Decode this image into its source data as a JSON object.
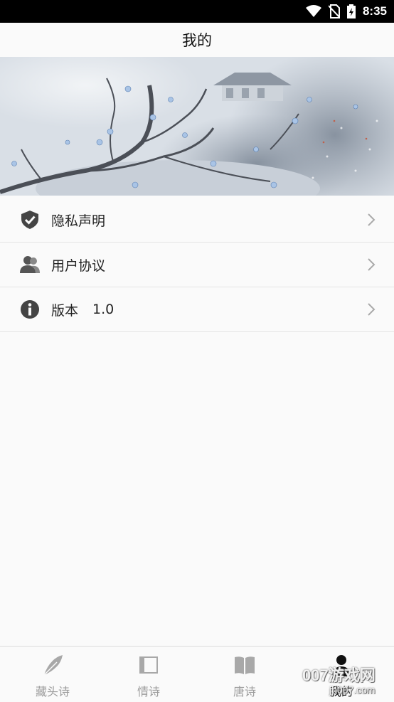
{
  "status_bar": {
    "time": "8:35",
    "icons": [
      "wifi-icon",
      "no-sim-icon",
      "battery-charging-icon"
    ]
  },
  "header": {
    "title": "我的"
  },
  "banner": {
    "alt": "ink-painting-banner"
  },
  "menu": {
    "items": [
      {
        "label": "隐私声明",
        "icon": "shield-check-icon"
      },
      {
        "label": "用户协议",
        "icon": "users-icon"
      },
      {
        "label": "版本",
        "value": "1.0",
        "icon": "info-icon"
      }
    ]
  },
  "tab_bar": {
    "tabs": [
      {
        "label": "藏头诗",
        "icon": "feather-icon",
        "active": false
      },
      {
        "label": "情诗",
        "icon": "book-icon",
        "active": false
      },
      {
        "label": "唐诗",
        "icon": "open-book-icon",
        "active": false
      },
      {
        "label": "我的",
        "icon": "person-icon",
        "active": true
      }
    ]
  },
  "watermark": {
    "top": "007游戏网",
    "bottom": "jb007.com"
  },
  "colors": {
    "background": "#fafafa",
    "text": "#222222",
    "inactive_tab": "#9b9b9b",
    "divider": "#e4e4e4"
  }
}
